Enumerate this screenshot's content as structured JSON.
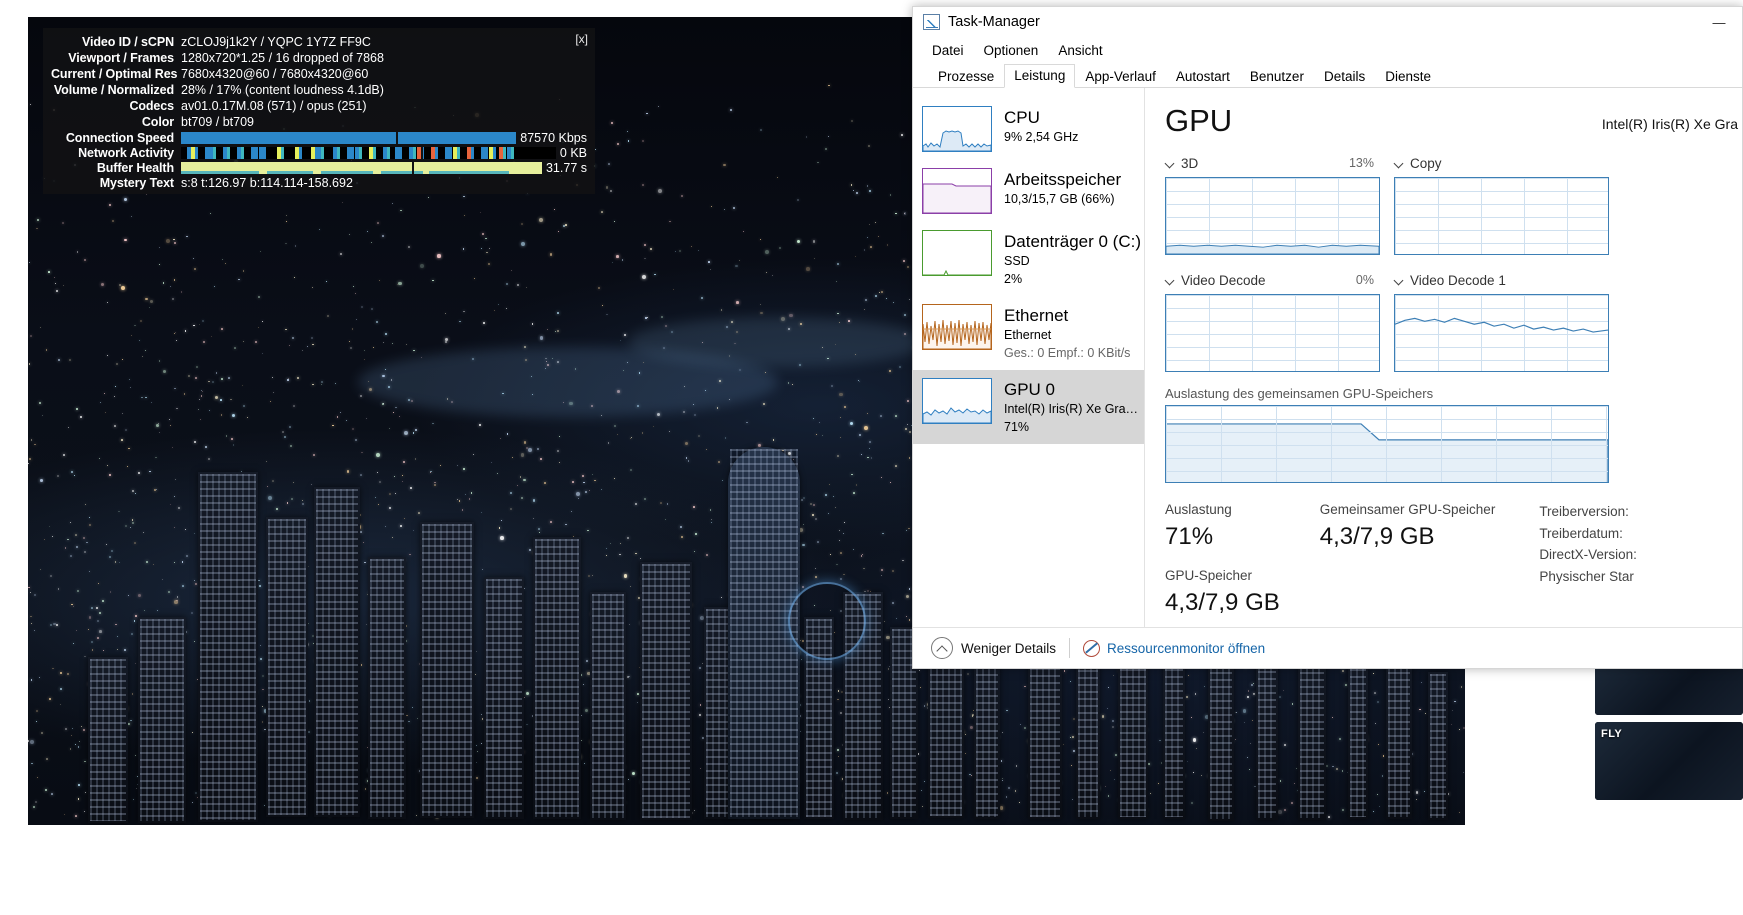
{
  "video_overlay": {
    "close_label": "[x]",
    "rows": [
      {
        "label": "Video ID / sCPN",
        "value": "zCLOJ9j1k2Y / YQPC 1Y7Z FF9C"
      },
      {
        "label": "Viewport / Frames",
        "value": "1280x720*1.25 / 16 dropped of 7868"
      },
      {
        "label": "Current / Optimal Res",
        "value": "7680x4320@60 / 7680x4320@60"
      },
      {
        "label": "Volume / Normalized",
        "value": "28% / 17% (content loudness 4.1dB)"
      },
      {
        "label": "Codecs",
        "value": "av01.0.17M.08 (571) / opus (251)"
      },
      {
        "label": "Color",
        "value": "bt709 / bt709"
      }
    ],
    "bars": [
      {
        "label": "Connection Speed",
        "value": "87570 Kbps"
      },
      {
        "label": "Network Activity",
        "value": "0 KB"
      },
      {
        "label": "Buffer Health",
        "value": "31.77 s"
      }
    ],
    "mystery": {
      "label": "Mystery Text",
      "value": "s:8 t:126.97 b:114.114-158.692"
    },
    "colors": {
      "connection_bar": "#2b87c9",
      "buffer_bar": "#e6ef9c",
      "network_bg": "#000000",
      "overlay_bg": "#121214"
    }
  },
  "side_thumbs": [
    {
      "title": ""
    },
    {
      "title": "FLY"
    }
  ],
  "task_manager": {
    "title": "Task-Manager",
    "app_icon": "task-manager-icon",
    "window_buttons": {
      "minimize": "—"
    },
    "menu": [
      "Datei",
      "Optionen",
      "Ansicht"
    ],
    "tabs": [
      {
        "label": "Prozesse",
        "active": false
      },
      {
        "label": "Leistung",
        "active": true
      },
      {
        "label": "App-Verlauf",
        "active": false
      },
      {
        "label": "Autostart",
        "active": false
      },
      {
        "label": "Benutzer",
        "active": false
      },
      {
        "label": "Details",
        "active": false
      },
      {
        "label": "Dienste",
        "active": false
      }
    ],
    "resources": [
      {
        "name": "CPU",
        "lines": [
          "9%  2,54 GHz"
        ],
        "accent": "#2f7fc1",
        "selected": false
      },
      {
        "name": "Arbeitsspeicher",
        "lines": [
          "10,3/15,7 GB (66%)"
        ],
        "accent": "#8b3fa8",
        "selected": false
      },
      {
        "name": "Datenträger 0 (C:)",
        "lines": [
          "SSD",
          "2%"
        ],
        "accent": "#4a9b2f",
        "selected": false
      },
      {
        "name": "Ethernet",
        "lines": [
          "Ethernet",
          "Ges.: 0  Empf.: 0 KBit/s"
        ],
        "accent": "#b5651d",
        "selected": false
      },
      {
        "name": "GPU 0",
        "lines": [
          "Intel(R) Iris(R) Xe Gra…",
          "71%"
        ],
        "accent": "#2f7fc1",
        "selected": true
      }
    ],
    "detail": {
      "heading": "GPU",
      "device_name": "Intel(R) Iris(R) Xe Gra",
      "graphs": [
        {
          "label": "3D",
          "pct": "13%"
        },
        {
          "label": "Copy",
          "pct": ""
        },
        {
          "label": "Video Decode",
          "pct": "0%"
        },
        {
          "label": "Video Decode 1",
          "pct": ""
        }
      ],
      "shared_memory_label": "Auslastung des gemeinsamen GPU-Speichers",
      "stats": [
        {
          "key": "Auslastung",
          "value": "71%"
        },
        {
          "key": "GPU-Speicher",
          "value": "4,3/7,9 GB"
        },
        {
          "key": "Gemeinsamer GPU-Speicher",
          "value": "4,3/7,9 GB"
        }
      ],
      "info": [
        "Treiberversion:",
        "Treiberdatum:",
        "DirectX-Version:",
        "Physischer Star"
      ]
    },
    "footer": {
      "less_details": "Weniger Details",
      "resource_monitor": "Ressourcenmonitor öffnen"
    }
  }
}
